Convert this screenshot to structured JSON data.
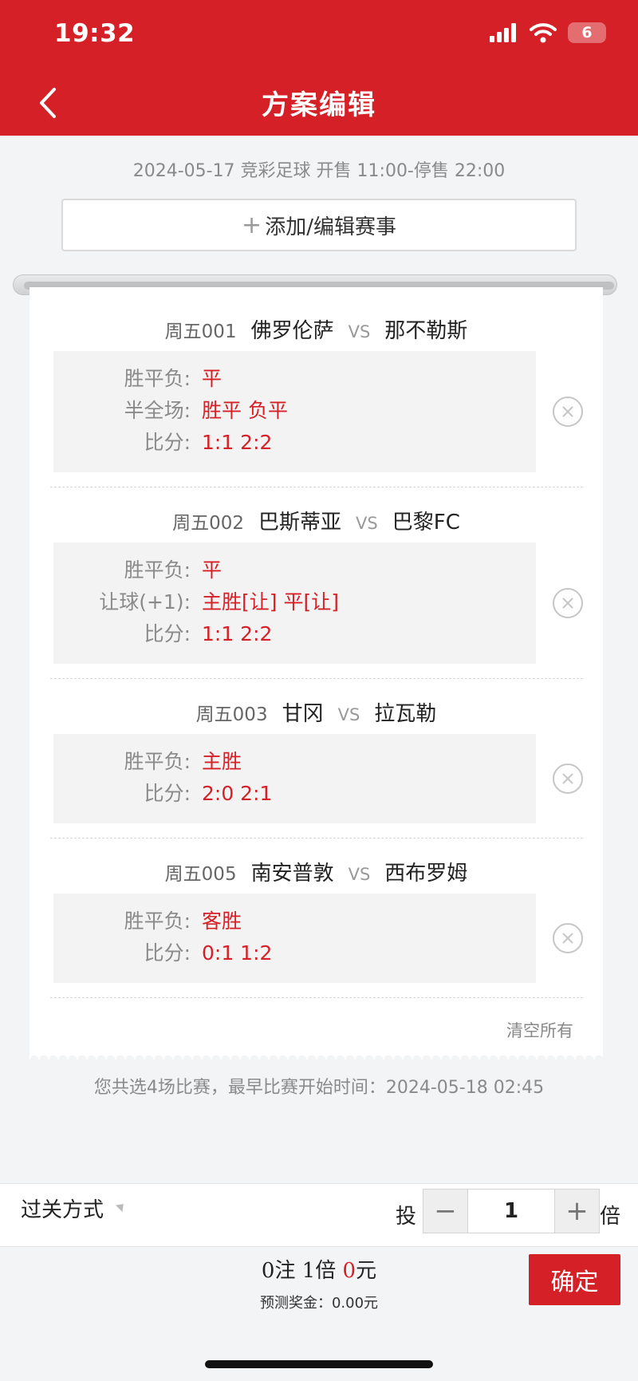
{
  "status_bar": {
    "time": "19:32",
    "battery": "6"
  },
  "header": {
    "title": "方案编辑"
  },
  "sale_info": "2024-05-17 竞彩足球 开售 11:00-停售 22:00",
  "add_button": {
    "plus": "+",
    "label": "添加/编辑赛事"
  },
  "matches": [
    {
      "num": "周五001",
      "home": "佛罗伦萨",
      "vs": "VS",
      "away": "那不勒斯",
      "picks": [
        {
          "label": "胜平负:",
          "value": "平"
        },
        {
          "label": "半全场:",
          "value": "胜平 负平"
        },
        {
          "label": "比分:",
          "value": "1:1 2:2"
        }
      ]
    },
    {
      "num": "周五002",
      "home": "巴斯蒂亚",
      "vs": "VS",
      "away": "巴黎FC",
      "picks": [
        {
          "label": "胜平负:",
          "value": "平"
        },
        {
          "label": "让球(+1):",
          "value": "主胜[让] 平[让]"
        },
        {
          "label": "比分:",
          "value": "1:1 2:2"
        }
      ]
    },
    {
      "num": "周五003",
      "home": "甘冈",
      "vs": "VS",
      "away": "拉瓦勒",
      "picks": [
        {
          "label": "胜平负:",
          "value": "主胜"
        },
        {
          "label": "比分:",
          "value": "2:0 2:1"
        }
      ]
    },
    {
      "num": "周五005",
      "home": "南安普敦",
      "vs": "VS",
      "away": "西布罗姆",
      "picks": [
        {
          "label": "胜平负:",
          "value": "客胜"
        },
        {
          "label": "比分:",
          "value": "0:1 1:2"
        }
      ]
    }
  ],
  "clear_all": "清空所有",
  "summary": "您共选4场比赛，最早比赛开始时间：2024-05-18 02:45",
  "bet_bar": {
    "pass_mode": "过关方式",
    "tou": "投",
    "minus": "−",
    "multiplier": "1",
    "plus": "+",
    "bei": "倍"
  },
  "footer": {
    "bets": "0",
    "bets_unit": "注",
    "multiple": "1",
    "multiple_unit": "倍",
    "amount": "0",
    "amount_unit": "元",
    "prize_label": "预测奖金：",
    "prize_value": "0.00元",
    "confirm": "确定"
  },
  "colors": {
    "brand_red": "#d42026"
  }
}
